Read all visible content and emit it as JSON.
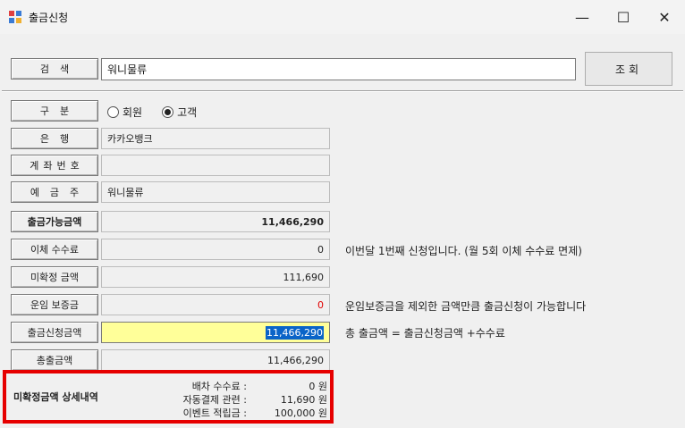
{
  "window": {
    "title": "출금신청",
    "minimize": "—",
    "maximize": "☐",
    "close": "✕"
  },
  "search": {
    "label": "검색",
    "value": "워니물류",
    "button": "조회"
  },
  "fields": {
    "division": {
      "label": "구분",
      "options": [
        "회원",
        "고객"
      ],
      "selected": "고객"
    },
    "bank": {
      "label": "은행",
      "value": "카카오뱅크"
    },
    "account": {
      "label": "계좌번호",
      "value": ""
    },
    "holder": {
      "label": "예금주",
      "value": "워니물류"
    },
    "available": {
      "label": "출금가능금액",
      "value": "11,466,290"
    },
    "fee": {
      "label": "이체 수수료",
      "value": "0",
      "note": "이번달 1번째 신청입니다. (월 5회 이체 수수료 면제)"
    },
    "unconfirmed": {
      "label": "미확정 금액",
      "value": "111,690"
    },
    "deposit": {
      "label": "운임 보증금",
      "value": "0",
      "note": "운임보증금을 제외한 금액만큼 출금신청이 가능합니다"
    },
    "request": {
      "label": "출금신청금액",
      "value": "11,466,290",
      "note": "총 출금액 = 출금신청금액 +수수료"
    },
    "total": {
      "label": "총출금액",
      "value": "11,466,290"
    }
  },
  "detail": {
    "title": "미확정금액 상세내역",
    "rows": [
      {
        "key": "배차 수수료 :",
        "value": "0 원"
      },
      {
        "key": "자동결제 관련 :",
        "value": "11,690 원"
      },
      {
        "key": "이벤트 적립금 :",
        "value": "100,000 원"
      }
    ]
  },
  "colors": {
    "highlight_frame": "#e60000",
    "input_yellow": "#ffff99",
    "selection": "#0a64c8",
    "negative_red": "#e00000"
  }
}
